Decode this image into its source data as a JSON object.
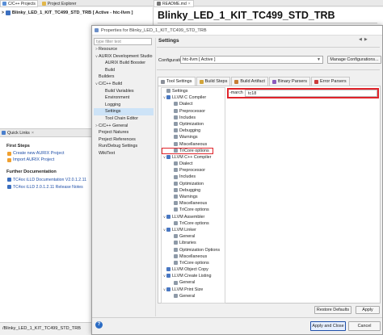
{
  "ide": {
    "nav_tabs": [
      "C/C++ Projects",
      "Project Explorer"
    ],
    "editor_tab": "README.md",
    "project_header": "Blinky_LED_1_KIT_TC499_STD_TRB [ Active - htc-llvm ]",
    "big_title": "Blinky_LED_1_KIT_TC499_STD_TRB",
    "quick_links": {
      "title": "Quick Links",
      "sections": [
        {
          "title": "First Steps",
          "links": [
            "Create new AURIX Project",
            "Import AURIX Project"
          ]
        },
        {
          "title": "Further Documentation",
          "links": [
            "TC4xx iLLD Documentation V2.0.1.2.11",
            "TC4xx iLLD 2.0.1.2.11 Release Notes"
          ]
        }
      ]
    },
    "status_path": "/Blinky_LED_1_KIT_TC499_STD_TRB"
  },
  "dialog": {
    "title": "Properties for Blinky_LED_1_KIT_TC499_STD_TRB",
    "filter_placeholder": "type filter text",
    "tree": [
      {
        "label": "Resource",
        "d": 0,
        "e": ">"
      },
      {
        "label": "AURIX Development Studio",
        "d": 0,
        "e": "v"
      },
      {
        "label": "AURIX Build Booster",
        "d": 1,
        "e": ""
      },
      {
        "label": "Build",
        "d": 1,
        "e": ""
      },
      {
        "label": "Builders",
        "d": 0,
        "e": ""
      },
      {
        "label": "C/C++ Build",
        "d": 0,
        "e": "v"
      },
      {
        "label": "Build Variables",
        "d": 1,
        "e": ""
      },
      {
        "label": "Environment",
        "d": 1,
        "e": ""
      },
      {
        "label": "Logging",
        "d": 1,
        "e": ""
      },
      {
        "label": "Settings",
        "d": 1,
        "e": "",
        "sel": true
      },
      {
        "label": "Tool Chain Editor",
        "d": 1,
        "e": ""
      },
      {
        "label": "C/C++ General",
        "d": 0,
        "e": ">"
      },
      {
        "label": "Project Natures",
        "d": 0,
        "e": ""
      },
      {
        "label": "Project References",
        "d": 0,
        "e": ""
      },
      {
        "label": "Run/Debug Settings",
        "d": 0,
        "e": ""
      },
      {
        "label": "WikiText",
        "d": 0,
        "e": ""
      }
    ],
    "page_title": "Settings",
    "config_label": "Configuration:",
    "config_value": "htc-llvm  [ Active ]",
    "manage_label": "Manage Configurations...",
    "tabs": [
      "Tool Settings",
      "Build Steps",
      "Build Artifact",
      "Binary Parsers",
      "Error Parsers"
    ],
    "tool_tree": [
      {
        "label": "Settings",
        "d": 0,
        "e": "",
        "ic": "gear"
      },
      {
        "label": "LLVM C Compiler",
        "d": 0,
        "e": "v",
        "ic": "tool"
      },
      {
        "label": "Dialect",
        "d": 1,
        "e": "",
        "ic": "gear"
      },
      {
        "label": "Preprocessor",
        "d": 1,
        "e": "",
        "ic": "gear"
      },
      {
        "label": "Includes",
        "d": 1,
        "e": "",
        "ic": "gear"
      },
      {
        "label": "Optimization",
        "d": 1,
        "e": "",
        "ic": "gear"
      },
      {
        "label": "Debugging",
        "d": 1,
        "e": "",
        "ic": "gear"
      },
      {
        "label": "Warnings",
        "d": 1,
        "e": "",
        "ic": "gear"
      },
      {
        "label": "Miscellaneous",
        "d": 1,
        "e": "",
        "ic": "gear"
      },
      {
        "label": "TriCore options",
        "d": 1,
        "e": "",
        "ic": "gear",
        "hl": true
      },
      {
        "label": "LLVM C++ Compiler",
        "d": 0,
        "e": "v",
        "ic": "tool"
      },
      {
        "label": "Dialect",
        "d": 1,
        "e": "",
        "ic": "gear"
      },
      {
        "label": "Preprocessor",
        "d": 1,
        "e": "",
        "ic": "gear"
      },
      {
        "label": "Includes",
        "d": 1,
        "e": "",
        "ic": "gear"
      },
      {
        "label": "Optimization",
        "d": 1,
        "e": "",
        "ic": "gear"
      },
      {
        "label": "Debugging",
        "d": 1,
        "e": "",
        "ic": "gear"
      },
      {
        "label": "Warnings",
        "d": 1,
        "e": "",
        "ic": "gear"
      },
      {
        "label": "Miscellaneous",
        "d": 1,
        "e": "",
        "ic": "gear"
      },
      {
        "label": "TriCore options",
        "d": 1,
        "e": "",
        "ic": "gear"
      },
      {
        "label": "LLVM Assembler",
        "d": 0,
        "e": "v",
        "ic": "tool"
      },
      {
        "label": "TriCore options",
        "d": 1,
        "e": "",
        "ic": "gear"
      },
      {
        "label": "LLVM Linker",
        "d": 0,
        "e": "v",
        "ic": "tool"
      },
      {
        "label": "General",
        "d": 1,
        "e": "",
        "ic": "gear"
      },
      {
        "label": "Libraries",
        "d": 1,
        "e": "",
        "ic": "gear"
      },
      {
        "label": "Optimization Options",
        "d": 1,
        "e": "",
        "ic": "gear"
      },
      {
        "label": "Miscellaneous",
        "d": 1,
        "e": "",
        "ic": "gear"
      },
      {
        "label": "TriCore options",
        "d": 1,
        "e": "",
        "ic": "gear"
      },
      {
        "label": "LLVM Object Copy",
        "d": 0,
        "e": "",
        "ic": "tool"
      },
      {
        "label": "LLVM Create Listing",
        "d": 0,
        "e": "v",
        "ic": "tool"
      },
      {
        "label": "General",
        "d": 1,
        "e": "",
        "ic": "gear"
      },
      {
        "label": "LLVM Print Size",
        "d": 0,
        "e": "v",
        "ic": "tool"
      },
      {
        "label": "General",
        "d": 1,
        "e": "",
        "ic": "gear"
      }
    ],
    "option_label": "-march",
    "option_value": "tc18",
    "restore_label": "Restore Defaults",
    "apply_label": "Apply",
    "apply_close_label": "Apply and Close",
    "cancel_label": "Cancel"
  },
  "colors": {
    "highlight": "#e0242b",
    "accent": "#1f4fa8",
    "selection": "#cde3f7"
  }
}
